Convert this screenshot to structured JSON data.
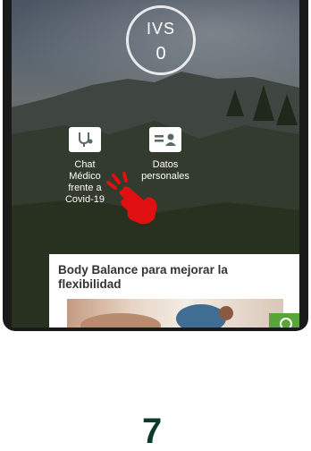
{
  "score": {
    "label": "IVS",
    "value": "0"
  },
  "shortcuts": [
    {
      "label_lines": [
        "Chat",
        "Médico",
        "frente a",
        "Covid-19"
      ],
      "icon": "stethoscope-chat-icon"
    },
    {
      "label_lines": [
        "Datos",
        "personales"
      ],
      "icon": "id-card-icon"
    }
  ],
  "article": {
    "title": "Body Balance para mejorar la flexibilidad"
  },
  "step_number": "7",
  "colors": {
    "accent_green": "#5aa53a",
    "step_number": "#0d3b2a",
    "pointer": "#e01010"
  }
}
